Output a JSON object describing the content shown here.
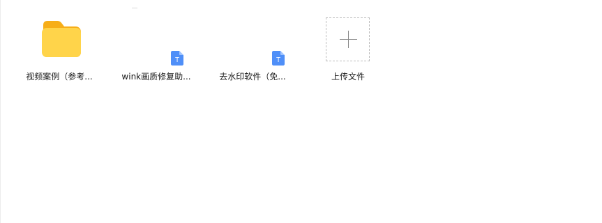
{
  "files": [
    {
      "name": "视频案例（参考...",
      "type": "folder",
      "icon": "folder-icon"
    },
    {
      "name": "wink画质修复助...",
      "type": "document",
      "icon": "doc-icon",
      "icon_letter": "T"
    },
    {
      "name": "去水印软件（免...",
      "type": "document",
      "icon": "doc-icon",
      "icon_letter": "T"
    }
  ],
  "upload": {
    "label": "上传文件",
    "icon": "plus-icon"
  },
  "colors": {
    "folder": "#ffcc33",
    "folder_tab": "#f7ae18",
    "doc_blue": "#4f8ff8",
    "text": "#1a1a1a",
    "border": "#bdbdbd"
  }
}
